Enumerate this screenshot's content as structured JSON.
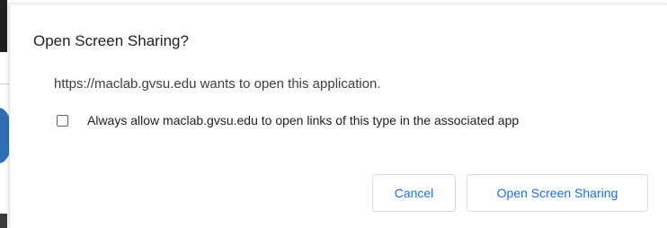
{
  "dialog": {
    "title": "Open Screen Sharing?",
    "message": "https://maclab.gvsu.edu wants to open this application.",
    "checkbox": {
      "label": "Always allow maclab.gvsu.edu to open links of this type in the associated app",
      "checked": false
    },
    "buttons": {
      "cancel_label": "Cancel",
      "open_label": "Open Screen Sharing"
    }
  },
  "colors": {
    "accent": "#1a73e8",
    "title_text": "#202124",
    "body_text": "#3c4043",
    "border": "#dadce0"
  }
}
